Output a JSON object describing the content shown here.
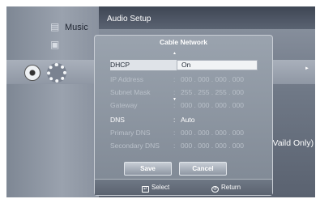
{
  "background": {
    "music_label": "Music",
    "audio_setup": "Audio Setup",
    "vaild_text": "(Vaild Only)"
  },
  "dialog": {
    "title": "Cable Network",
    "rows": [
      {
        "label": "DHCP",
        "value": "On"
      },
      {
        "label": "IP Address",
        "value": "000 . 000 . 000 . 000"
      },
      {
        "label": "Subnet Mask",
        "value": "255 . 255 . 255 . 000"
      },
      {
        "label": "Gateway",
        "value": "000 . 000 . 000 . 000"
      },
      {
        "label": "DNS",
        "value": "Auto"
      },
      {
        "label": "Primary DNS",
        "value": "000 . 000 . 000 . 000"
      },
      {
        "label": "Secondary DNS",
        "value": "000 . 000 . 000 . 000"
      }
    ],
    "colon": ":",
    "save_label": "Save",
    "cancel_label": "Cancel",
    "select_hint": "Select",
    "return_hint": "Return"
  },
  "icons": {
    "music": "music-icon",
    "photo": "photo-icon",
    "disc": "disc-icon",
    "setup": "gear-icon",
    "select": "enter-icon",
    "return": "return-icon"
  }
}
